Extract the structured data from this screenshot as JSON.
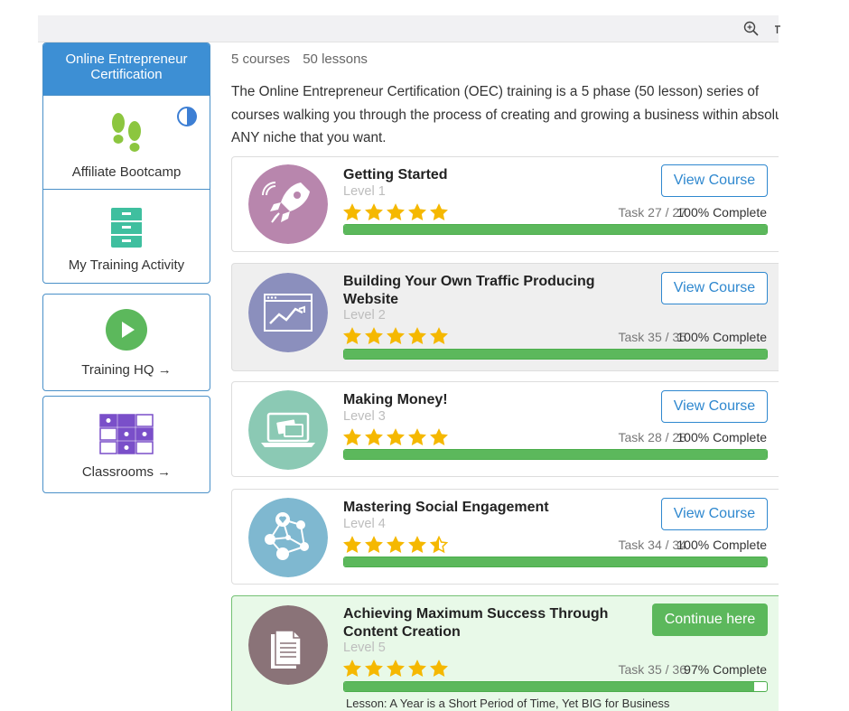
{
  "sidebar": {
    "header": "Online Entrepreneur Certification",
    "items": [
      {
        "label": "Affiliate Bootcamp",
        "icon": "footprints-icon"
      },
      {
        "label": "My Training Activity",
        "icon": "drawer-cabinet-icon"
      }
    ],
    "training_hq": {
      "label": "Training HQ →",
      "icon": "play-circle-icon"
    },
    "classrooms": {
      "label": "Classrooms →",
      "icon": "grid-classroom-icon"
    }
  },
  "main": {
    "stats": {
      "courses": "5 courses",
      "lessons": "50 lessons"
    },
    "description": "The Online Entrepreneur Certification (OEC) training is a 5 phase (50 lesson) series of courses walking you through the process of creating and growing a business within absolutely ANY niche that you want."
  },
  "courses": [
    {
      "title": "Getting Started",
      "level": "Level 1",
      "rating": 5,
      "task": "Task 27 / 27",
      "percent": "100% Complete",
      "progress": 1.0,
      "button": "View Course",
      "icon": "rocket-icon",
      "color": "#b886ad"
    },
    {
      "title": "Building Your Own Traffic Producing Website",
      "level": "Level 2",
      "rating": 5,
      "task": "Task 35 / 35",
      "percent": "100% Complete",
      "progress": 1.0,
      "button": "View Course",
      "icon": "website-chart-icon",
      "color": "#8b8fbd"
    },
    {
      "title": "Making Money!",
      "level": "Level 3",
      "rating": 5,
      "task": "Task 28 / 28",
      "percent": "100% Complete",
      "progress": 1.0,
      "button": "View Course",
      "icon": "laptop-card-icon",
      "color": "#8bc9b4"
    },
    {
      "title": "Mastering Social Engagement",
      "level": "Level 4",
      "rating": 4.5,
      "task": "Task 34 / 34",
      "percent": "100% Complete",
      "progress": 1.0,
      "button": "View Course",
      "icon": "social-network-icon",
      "color": "#7fb8d0"
    },
    {
      "title": "Achieving Maximum Success Through Content Creation",
      "level": "Level 5",
      "rating": 5,
      "task": "Task 35 / 36",
      "percent": "97% Complete",
      "progress": 0.97,
      "button": "Continue here",
      "icon": "documents-icon",
      "color": "#8a7378",
      "lesson": "Lesson: A Year is a Short Period of Time, Yet BIG for Business"
    }
  ],
  "colors": {
    "accent": "#3d8fd4",
    "success": "#5cb85c",
    "star": "#f5b800"
  }
}
